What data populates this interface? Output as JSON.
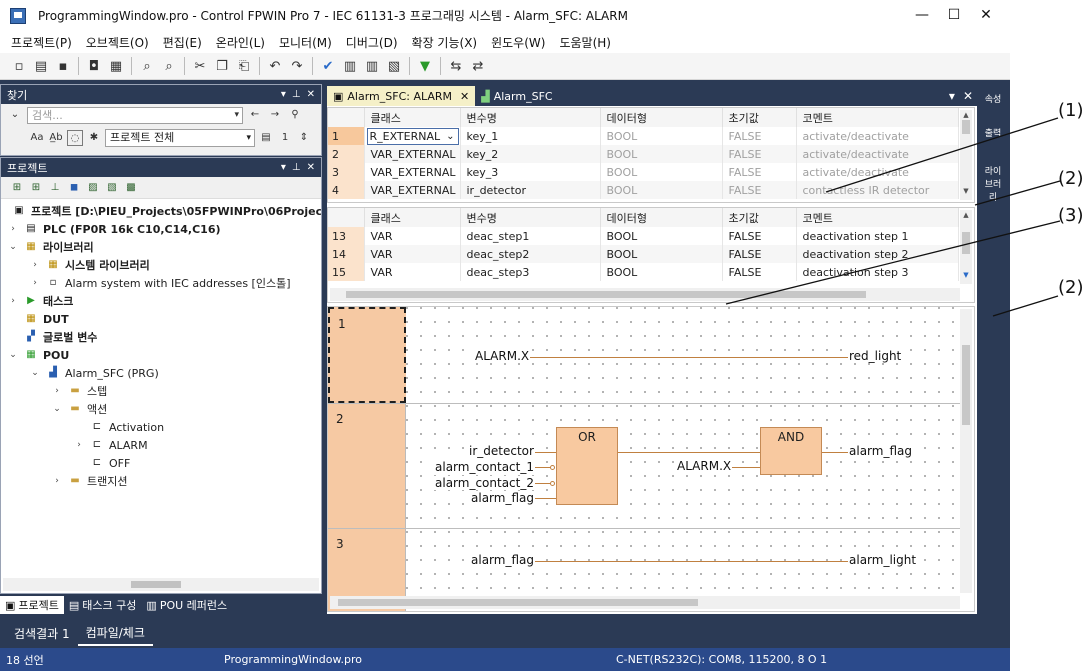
{
  "window": {
    "title": "ProgrammingWindow.pro - Control FPWIN Pro 7 - IEC 61131-3 프로그래밍 시스템 - Alarm_SFC: ALARM",
    "minimize": "—",
    "maximize": "☐",
    "close": "✕"
  },
  "menu": [
    "프로젝트(P)",
    "오브젝트(O)",
    "편집(E)",
    "온라인(L)",
    "모니터(M)",
    "디버그(D)",
    "확장 기능(X)",
    "윈도우(W)",
    "도움말(H)"
  ],
  "find_panel": {
    "title": "찾기",
    "search_placeholder": "검색...",
    "scope": "프로젝트 전체",
    "count": "1",
    "case_label": "Aa",
    "word_label": "A̲b"
  },
  "project_panel": {
    "title": "프로젝트",
    "tree": [
      {
        "label": "프로젝트 [D:\\PIEU_Projects\\05FPWINPro\\06Projects\\",
        "bold": true
      },
      {
        "label": "PLC (FP0R 16k C10,C14,C16)",
        "bold": true
      },
      {
        "label": "라이브러리",
        "bold": true
      },
      {
        "label": "시스템 라이브러리",
        "bold": true
      },
      {
        "label": "Alarm system with IEC addresses [인스톨]",
        "bold": false
      },
      {
        "label": "태스크",
        "bold": true
      },
      {
        "label": "DUT",
        "bold": true
      },
      {
        "label": "글로벌 변수",
        "bold": true
      },
      {
        "label": "POU",
        "bold": true
      },
      {
        "label": "Alarm_SFC (PRG)",
        "bold": false
      },
      {
        "label": "스텝",
        "bold": false
      },
      {
        "label": "액션",
        "bold": false
      },
      {
        "label": "Activation",
        "bold": false
      },
      {
        "label": "ALARM",
        "bold": false
      },
      {
        "label": "OFF",
        "bold": false
      },
      {
        "label": "트랜지션",
        "bold": false
      }
    ]
  },
  "bottom_tabs": [
    "프로젝트",
    "태스크 구성",
    "POU 레퍼런스"
  ],
  "output_tabs": [
    "검색결과 1",
    "컴파일/체크"
  ],
  "status": {
    "line": "18 선언",
    "file": "ProgrammingWindow.pro",
    "connection": "C-NET(RS232C): COM8, 115200, 8 O 1"
  },
  "doc_tabs": [
    {
      "label": "Alarm_SFC: ALARM",
      "close": "✕"
    },
    {
      "label": "Alarm_SFC"
    }
  ],
  "doc_tab_controls": {
    "menu": "▾",
    "close": "✕"
  },
  "side_tabs": [
    "속성",
    "출력",
    "라이브러리"
  ],
  "grid_headers": [
    "클래스",
    "변수명",
    "데이터형",
    "초기값",
    "코멘트"
  ],
  "grid_top": [
    {
      "num": "1",
      "class": "R_EXTERNAL",
      "name": "key_1",
      "type": "BOOL",
      "init": "FALSE",
      "comment": "activate/deactivate"
    },
    {
      "num": "2",
      "class": "VAR_EXTERNAL",
      "name": "key_2",
      "type": "BOOL",
      "init": "FALSE",
      "comment": "activate/deactivate"
    },
    {
      "num": "3",
      "class": "VAR_EXTERNAL",
      "name": "key_3",
      "type": "BOOL",
      "init": "FALSE",
      "comment": "activate/deactivate"
    },
    {
      "num": "4",
      "class": "VAR_EXTERNAL",
      "name": "ir_detector",
      "type": "BOOL",
      "init": "FALSE",
      "comment": "contactless IR detector"
    }
  ],
  "grid_bottom": [
    {
      "num": "13",
      "class": "VAR",
      "name": "deac_step1",
      "type": "BOOL",
      "init": "FALSE",
      "comment": "deactivation step 1"
    },
    {
      "num": "14",
      "class": "VAR",
      "name": "deac_step2",
      "type": "BOOL",
      "init": "FALSE",
      "comment": "deactivation step 2"
    },
    {
      "num": "15",
      "class": "VAR",
      "name": "deac_step3",
      "type": "BOOL",
      "init": "FALSE",
      "comment": "deactivation step 3"
    }
  ],
  "ladder": {
    "rung1": {
      "num": "1",
      "input": "ALARM.X",
      "output": "red_light"
    },
    "rung2": {
      "num": "2",
      "or_block": "OR",
      "and_block": "AND",
      "or_inputs": [
        "ir_detector",
        "alarm_contact_1",
        "alarm_contact_2",
        "alarm_flag"
      ],
      "and_input": "ALARM.X",
      "output": "alarm_flag"
    },
    "rung3": {
      "num": "3",
      "input": "alarm_flag",
      "output": "alarm_light"
    }
  },
  "annotations": [
    "(1)",
    "(2)",
    "(3)",
    "(2)"
  ]
}
